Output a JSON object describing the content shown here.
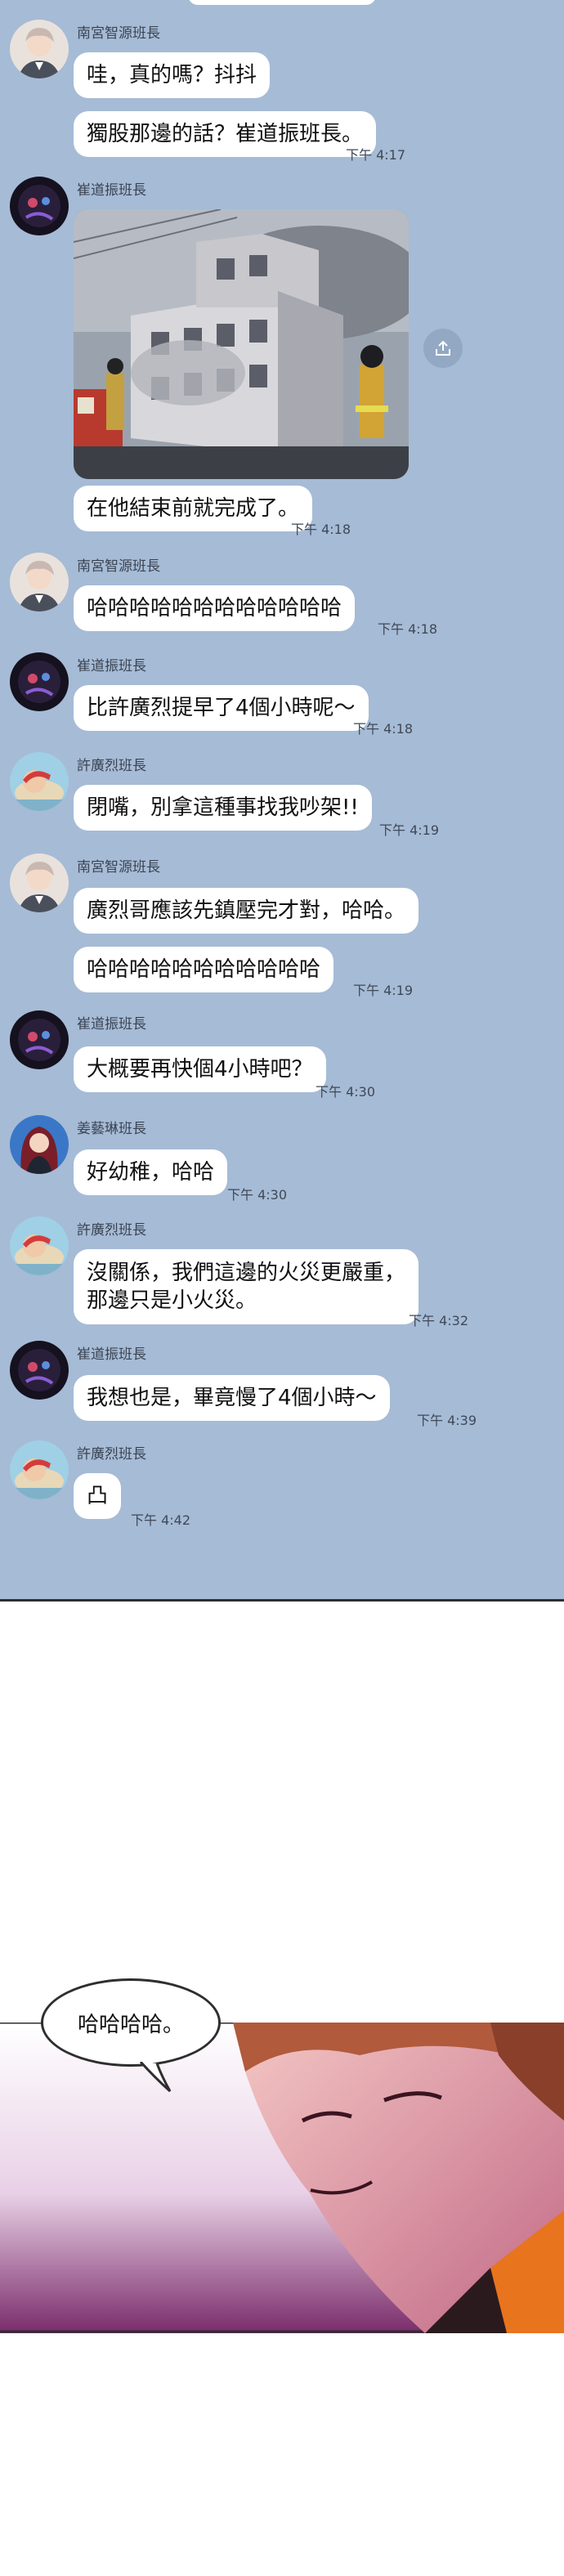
{
  "messages": [
    {
      "sender": "南宮智源班長",
      "avatar_icon": "avatar-nangong",
      "bubbles": [
        "哇，真的嗎？抖抖",
        "獨股那邊的話？崔道振班長。"
      ],
      "time": "下午 4:17"
    },
    {
      "sender": "崔道振班長",
      "avatar_icon": "avatar-cui",
      "photo": "burning-building-photo",
      "bubbles": [
        "在他結束前就完成了。"
      ],
      "time": "下午 4:18"
    },
    {
      "sender": "南宮智源班長",
      "avatar_icon": "avatar-nangong",
      "bubbles": [
        "哈哈哈哈哈哈哈哈哈哈哈哈"
      ],
      "time": "下午 4:18"
    },
    {
      "sender": "崔道振班長",
      "avatar_icon": "avatar-cui",
      "bubbles": [
        "比許廣烈提早了4個小時呢～"
      ],
      "time": "下午 4:18"
    },
    {
      "sender": "許廣烈班長",
      "avatar_icon": "avatar-heo",
      "bubbles": [
        "閉嘴，別拿這種事找我吵架!!"
      ],
      "time": "下午 4:19"
    },
    {
      "sender": "南宮智源班長",
      "avatar_icon": "avatar-nangong",
      "bubbles": [
        "廣烈哥應該先鎮壓完才對，哈哈。",
        "哈哈哈哈哈哈哈哈哈哈哈"
      ],
      "time": "下午 4:19"
    },
    {
      "sender": "崔道振班長",
      "avatar_icon": "avatar-cui",
      "bubbles": [
        "大概要再快個4小時吧？"
      ],
      "time": "下午 4:30"
    },
    {
      "sender": "姜藝琳班長",
      "avatar_icon": "avatar-kang",
      "bubbles": [
        "好幼稚，哈哈"
      ],
      "time": "下午 4:30"
    },
    {
      "sender": "許廣烈班長",
      "avatar_icon": "avatar-heo",
      "bubbles": [
        "沒關係，我們這邊的火災更嚴重，\n那邊只是小火災。"
      ],
      "time": "下午 4:32"
    },
    {
      "sender": "崔道振班長",
      "avatar_icon": "avatar-cui",
      "bubbles": [
        "我想也是，畢竟慢了4個小時～"
      ],
      "time": "下午 4:39"
    },
    {
      "sender": "許廣烈班長",
      "avatar_icon": "avatar-heo",
      "bubbles": [
        "凸"
      ],
      "time": "下午 4:42"
    }
  ],
  "comic": {
    "speech": "哈哈哈哈。"
  },
  "colors": {
    "chat_bg": "#a6bbd5",
    "bubble": "#ffffff"
  }
}
